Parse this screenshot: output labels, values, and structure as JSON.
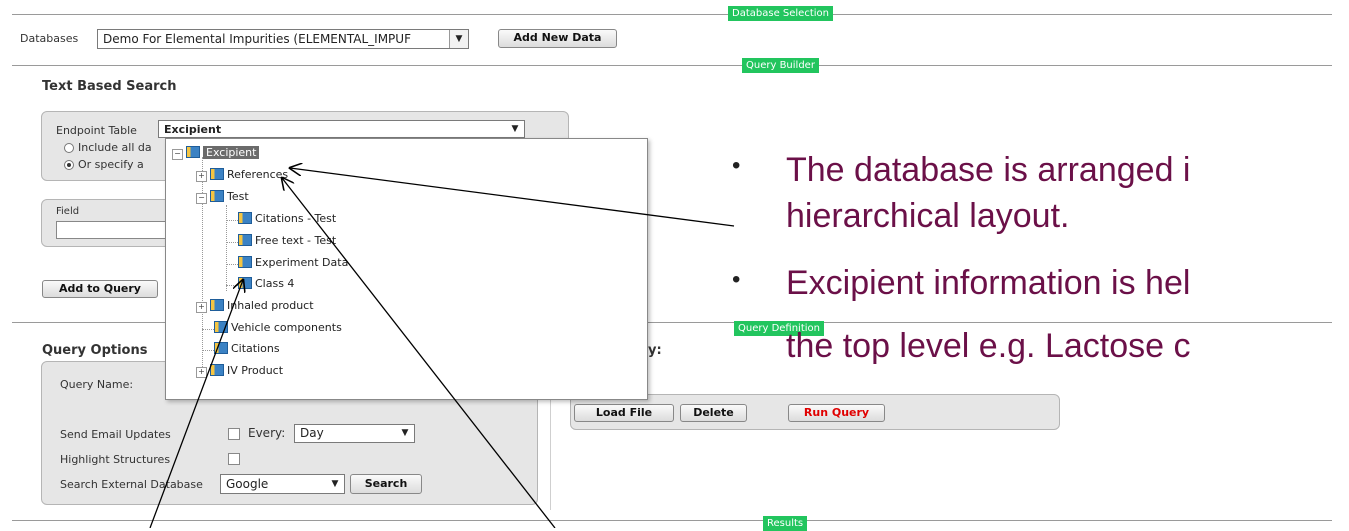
{
  "sections": {
    "database_selection": "Database Selection",
    "query_builder": "Query Builder",
    "query_definition": "Query Definition",
    "results": "Results"
  },
  "database_bar": {
    "label": "Databases",
    "selected": "Demo For Elemental Impurities (ELEMENTAL_IMPUF",
    "add_button": "Add New Data"
  },
  "text_search": {
    "title": "Text Based Search",
    "endpoint_label": "Endpoint Table",
    "endpoint_value": "Excipient",
    "radio_include": "Include all da",
    "radio_specify": "Or specify a",
    "field_label": "Field",
    "add_to_query": "Add to Query"
  },
  "tree": {
    "root": "Excipient",
    "items": [
      {
        "label": "References"
      },
      {
        "label": "Test"
      },
      {
        "label": "Citations - Test"
      },
      {
        "label": "Free text - Test"
      },
      {
        "label": "Experiment Data"
      },
      {
        "label": "Class 4"
      },
      {
        "label": "Inhaled product"
      },
      {
        "label": "Vehicle components"
      },
      {
        "label": "Citations"
      },
      {
        "label": "IV Product"
      }
    ]
  },
  "query_options": {
    "title": "Query Options",
    "query_name_label": "Query Name:",
    "send_email_label": "Send Email Updates",
    "every_label": "Every:",
    "every_value": "Day",
    "highlight_label": "Highlight Structures",
    "external_label": "Search External Database",
    "external_value": "Google",
    "search_button": "Search"
  },
  "query_definition": {
    "label_fragment": "y:",
    "load_file": "Load File",
    "delete": "Delete",
    "run_query": "Run Query",
    "run_query_color": "#e00000"
  },
  "bullets": [
    {
      "line1": "The database is arranged i",
      "line2": "hierarchical layout."
    },
    {
      "line1": "Excipient information is hel",
      "line2": "the top level e.g. Lactose c"
    }
  ],
  "colors": {
    "bullet_text": "#6b1048",
    "section_tag": "#22c55e"
  }
}
